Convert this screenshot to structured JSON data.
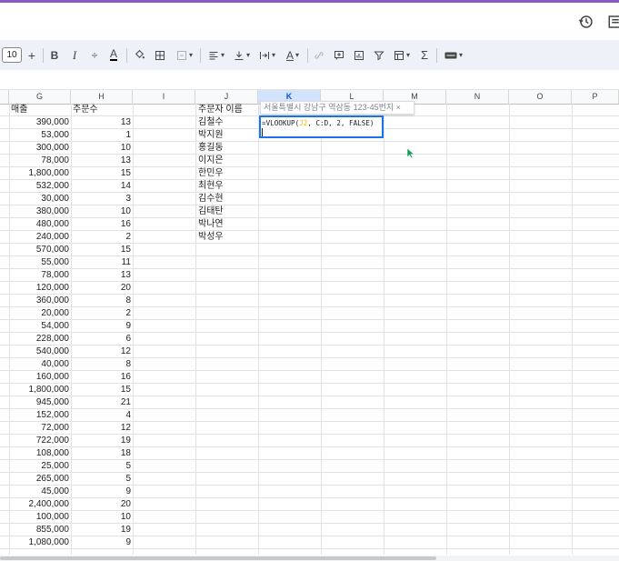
{
  "toolbar": {
    "font_size": "10",
    "plus": "+",
    "bold": "B",
    "italic": "I",
    "strike": "÷",
    "text_color": "A",
    "wrap_label": "A",
    "sum": "Σ"
  },
  "columns": [
    "G",
    "H",
    "I",
    "J",
    "K",
    "L",
    "M",
    "N",
    "O",
    "P"
  ],
  "selected_column": "K",
  "headers": {
    "g": "매출",
    "h": "주문수",
    "j": "주문자 이름"
  },
  "rows": [
    {
      "g": "390,000",
      "h": "13",
      "j": "김철수"
    },
    {
      "g": "53,000",
      "h": "1",
      "j": "박지원"
    },
    {
      "g": "300,000",
      "h": "10",
      "j": "홍길동"
    },
    {
      "g": "78,000",
      "h": "13",
      "j": "이지은"
    },
    {
      "g": "1,800,000",
      "h": "15",
      "j": "한민우"
    },
    {
      "g": "532,000",
      "h": "14",
      "j": "최현우"
    },
    {
      "g": "30,000",
      "h": "3",
      "j": "김수현"
    },
    {
      "g": "380,000",
      "h": "10",
      "j": "김태탄"
    },
    {
      "g": "480,000",
      "h": "16",
      "j": "박나연"
    },
    {
      "g": "240,000",
      "h": "2",
      "j": "박성우"
    },
    {
      "g": "570,000",
      "h": "15",
      "j": ""
    },
    {
      "g": "55,000",
      "h": "11",
      "j": ""
    },
    {
      "g": "78,000",
      "h": "13",
      "j": ""
    },
    {
      "g": "120,000",
      "h": "20",
      "j": ""
    },
    {
      "g": "360,000",
      "h": "8",
      "j": ""
    },
    {
      "g": "20,000",
      "h": "2",
      "j": ""
    },
    {
      "g": "54,000",
      "h": "9",
      "j": ""
    },
    {
      "g": "228,000",
      "h": "6",
      "j": ""
    },
    {
      "g": "540,000",
      "h": "12",
      "j": ""
    },
    {
      "g": "40,000",
      "h": "8",
      "j": ""
    },
    {
      "g": "160,000",
      "h": "16",
      "j": ""
    },
    {
      "g": "1,800,000",
      "h": "15",
      "j": ""
    },
    {
      "g": "945,000",
      "h": "21",
      "j": ""
    },
    {
      "g": "152,000",
      "h": "4",
      "j": ""
    },
    {
      "g": "72,000",
      "h": "12",
      "j": ""
    },
    {
      "g": "722,000",
      "h": "19",
      "j": ""
    },
    {
      "g": "108,000",
      "h": "18",
      "j": ""
    },
    {
      "g": "25,000",
      "h": "5",
      "j": ""
    },
    {
      "g": "265,000",
      "h": "5",
      "j": ""
    },
    {
      "g": "45,000",
      "h": "9",
      "j": ""
    },
    {
      "g": "2,400,000",
      "h": "20",
      "j": ""
    },
    {
      "g": "100,000",
      "h": "10",
      "j": ""
    },
    {
      "g": "855,000",
      "h": "19",
      "j": ""
    },
    {
      "g": "1,080,000",
      "h": "9",
      "j": ""
    }
  ],
  "editor": {
    "formula_prefix": "=VLOOKUP(",
    "formula_ref": "J2",
    "formula_suffix": ", C:D, 2, FALSE)",
    "tooltip": "서울특별시 강남구 역삼동 123-45번지 ×"
  },
  "colors": {
    "accent": "#1a73e8",
    "brand": "#8a5cc7",
    "toolbar_bg": "#eef2f8"
  }
}
